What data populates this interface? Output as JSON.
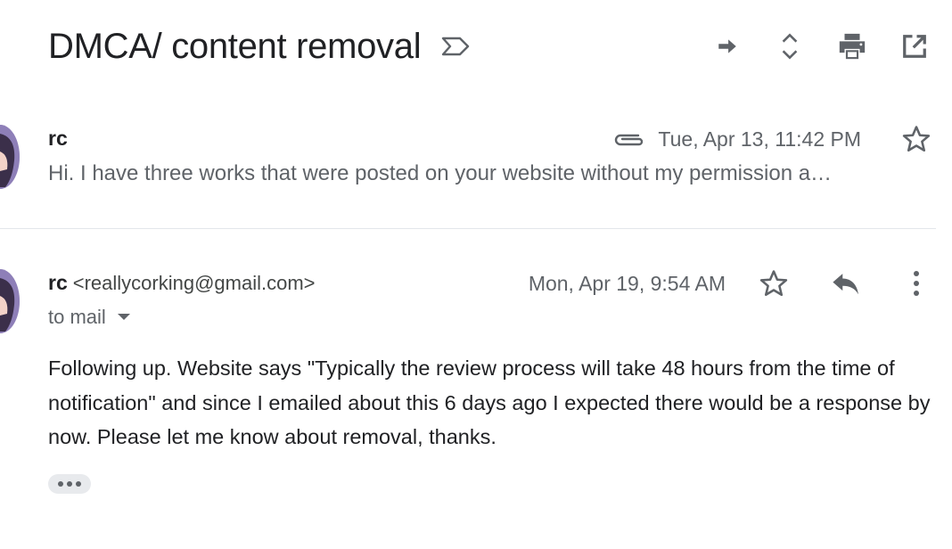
{
  "thread": {
    "subject": "DMCA/ content removal"
  },
  "toolbar": {
    "icons": [
      "forward-arrow-icon",
      "expand-collapse-icon",
      "print-icon",
      "open-in-new-window-icon"
    ]
  },
  "messages": [
    {
      "sender": "rc",
      "date": "Tue, Apr 13, 11:42 PM",
      "snippet": "Hi. I have three works that were posted on your website without my permission a…",
      "has_attachment": true,
      "starred": false
    },
    {
      "sender": "rc",
      "sender_email": "<reallycorking@gmail.com>",
      "date": "Mon, Apr 19, 9:54 AM",
      "to": "to mail",
      "starred": false,
      "body": "Following up. Website says \"Typically the review process will take 48 hours from the time of notification\" and since I emailed about this 6 days ago I expected there would be a response by now. Please let me know about removal, thanks."
    }
  ],
  "colors": {
    "icon": "#5f6368",
    "text_primary": "#202124",
    "text_secondary": "#5f6368",
    "divider": "#e3e6ea",
    "chip_bg": "#e8eaed"
  }
}
